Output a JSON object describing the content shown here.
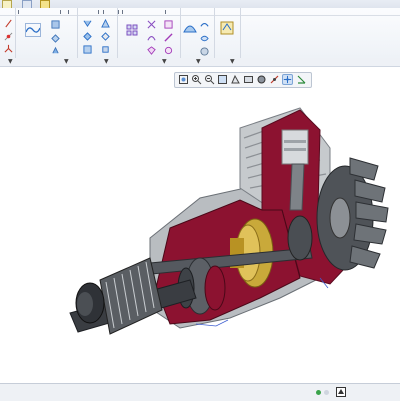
{
  "app": {
    "title": "",
    "accent": "#5b8fd1",
    "background": "#ffffff"
  },
  "quick_access": [
    "new-icon",
    "open-icon",
    "save-icon",
    "undo-icon",
    "redo-icon",
    "regen-icon",
    "window-icon"
  ],
  "ribbon": {
    "group_dropdowns": [
      "▼",
      "▼",
      "▼",
      "▼",
      "▼",
      "▼"
    ],
    "groups": [
      {
        "name": "datum-group",
        "icons": [
          "axis-icon",
          "point-icon",
          "csys-icon",
          "sketch-icon"
        ]
      },
      {
        "name": "shapes-group",
        "icons": [
          "extrude-icon",
          "revolve-icon",
          "sweep-icon",
          "blend-icon"
        ]
      },
      {
        "name": "engineering-group",
        "icons": [
          "hole-icon",
          "round-icon",
          "chamfer-icon",
          "draft-icon",
          "shell-icon",
          "rib-icon"
        ]
      },
      {
        "name": "editing-group",
        "icons": [
          "pattern-icon",
          "mirror-icon",
          "trim-icon",
          "merge-icon",
          "extend-icon",
          "offset-icon"
        ]
      },
      {
        "name": "surfaces-group",
        "icons": [
          "boundary-blend-icon",
          "style-icon",
          "freestyle-icon"
        ]
      },
      {
        "name": "model-intent-group",
        "icons": [
          "component-interface-icon"
        ]
      }
    ]
  },
  "view_toolbar": {
    "buttons": [
      "refit-icon",
      "zoom-in-icon",
      "zoom-out-icon",
      "repaint-icon",
      "perspective-icon",
      "saved-views-icon",
      "display-style-icon",
      "datum-display-icon",
      "spin-center-icon",
      "annotation-display-icon"
    ],
    "active_index": 8
  },
  "status_bar": {
    "indicators": [
      "status-ok-icon",
      "status-busy-icon"
    ],
    "colors": {
      "ok": "#3aa34a",
      "busy": "#cfd5df"
    }
  },
  "model": {
    "description_icon": "engine-cutaway-model",
    "colors": {
      "housing": "#8c1230",
      "gear": "#c9a93a",
      "metal": "#bfc3c7",
      "dark": "#3a3d42"
    }
  }
}
